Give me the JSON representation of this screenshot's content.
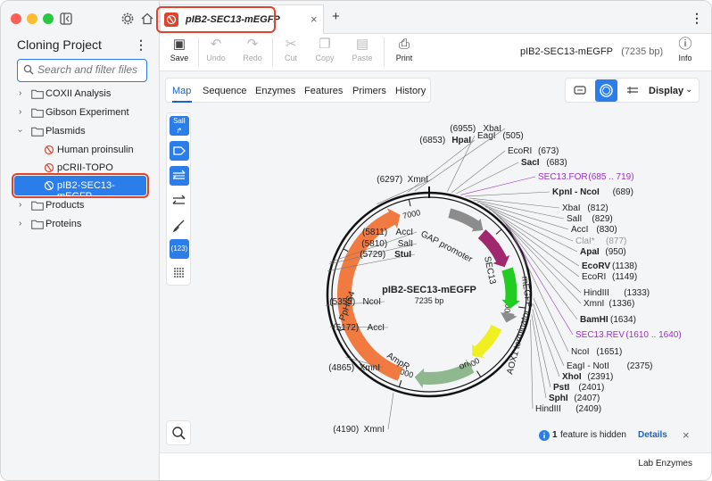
{
  "sidebar": {
    "title": "Cloning Project",
    "search_placeholder": "Search and filter files",
    "items": [
      {
        "label": "COXII Analysis"
      },
      {
        "label": "Gibson Experiment"
      },
      {
        "label": "Plasmids"
      },
      {
        "label": "Human proinsulin"
      },
      {
        "label": "pCRII-TOPO"
      },
      {
        "label": "pIB2-SEC13-mEGFP"
      },
      {
        "label": "Products"
      },
      {
        "label": "Proteins"
      }
    ]
  },
  "tab": {
    "name": "pIB2-SEC13-mEGFP"
  },
  "toolbar": {
    "save": "Save",
    "undo": "Undo",
    "redo": "Redo",
    "cut": "Cut",
    "copy": "Copy",
    "paste": "Paste",
    "print": "Print",
    "info": "Info"
  },
  "sequence": {
    "name": "pIB2-SEC13-mEGFP",
    "length": "(7235 bp)"
  },
  "view_tabs": [
    "Map",
    "Sequence",
    "Enzymes",
    "Features",
    "Primers",
    "History"
  ],
  "display_label": "Display",
  "map": {
    "title": "pIB2-SEC13-mEGFP",
    "length": "7235 bp",
    "total_bp": 7235,
    "ticks": [
      "1000",
      "2000",
      "3000",
      "4000",
      "5000",
      "6000",
      "7000"
    ],
    "features": [
      {
        "name": "GAP promoter",
        "color": "#8c8c8c"
      },
      {
        "name": "SEC13",
        "color": "#a0286f"
      },
      {
        "name": "mEGFP",
        "color": "#22cc22"
      },
      {
        "name": "AOX1 terminator",
        "color": "#8c8c8c"
      },
      {
        "name": "ori",
        "color": "#f0f020"
      },
      {
        "name": "AmpR",
        "color": "#8fb88f"
      },
      {
        "name": "PpHIS4",
        "color": "#f07a40"
      }
    ],
    "sites_right": [
      {
        "name": "EagI",
        "pos": "(505)"
      },
      {
        "name": "EcoRI",
        "pos": "(673)"
      },
      {
        "name": "SacI",
        "pos": "(683)",
        "bold": true
      },
      {
        "name": "SEC13.FOR",
        "pos": "(685 .. 719)",
        "primer": true
      },
      {
        "name": "KpnI",
        "extra": "NcoI",
        "pos": "(689)",
        "bold": true
      },
      {
        "name": "XbaI",
        "pos": "(812)"
      },
      {
        "name": "SalI",
        "pos": "(829)"
      },
      {
        "name": "AccI",
        "pos": "(830)"
      },
      {
        "name": "ClaI*",
        "pos": "(877)",
        "gray": true
      },
      {
        "name": "ApaI",
        "pos": "(950)",
        "bold": true
      },
      {
        "name": "EcoRV",
        "pos": "(1138)",
        "bold": true
      },
      {
        "name": "EcoRI",
        "pos": "(1149)"
      },
      {
        "name": "HindIII",
        "pos": "(1333)"
      },
      {
        "name": "XmnI",
        "pos": "(1336)"
      },
      {
        "name": "BamHI",
        "pos": "(1634)",
        "bold": true
      },
      {
        "name": "SEC13.REV",
        "pos": "(1610 .. 1640)",
        "primer": true
      },
      {
        "name": "NcoI",
        "pos": "(1651)"
      },
      {
        "name": "EagI",
        "extra": "NotI",
        "pos": "(2375)"
      },
      {
        "name": "XhoI",
        "pos": "(2391)",
        "bold": true
      },
      {
        "name": "PstI",
        "pos": "(2401)",
        "bold": true
      },
      {
        "name": "SphI",
        "pos": "(2407)",
        "bold": true
      },
      {
        "name": "HindIII",
        "pos": "(2409)"
      }
    ],
    "sites_left": [
      {
        "name": "XbaI",
        "pos": "(6955)"
      },
      {
        "name": "HpaI",
        "pos": "(6853)",
        "bold": true
      },
      {
        "name": "XmnI",
        "pos": "(6297)"
      },
      {
        "name": "AccI",
        "pos": "(5811)"
      },
      {
        "name": "SalI",
        "pos": "(5810)"
      },
      {
        "name": "StuI",
        "pos": "(5729)",
        "bold": true
      },
      {
        "name": "NcoI",
        "pos": "(5355)"
      },
      {
        "name": "AccI",
        "pos": "(5172)"
      },
      {
        "name": "XmnI",
        "pos": "(4865)"
      },
      {
        "name": "XmnI",
        "pos": "(4190)"
      }
    ]
  },
  "hidden_notice": {
    "count": "1",
    "text": "feature is hidden",
    "action": "Details"
  },
  "footer": {
    "label": "Lab Enzymes"
  },
  "colors": {
    "accent": "#2b7de9",
    "highlight": "#e0422b",
    "primer": "#9b30c8"
  }
}
